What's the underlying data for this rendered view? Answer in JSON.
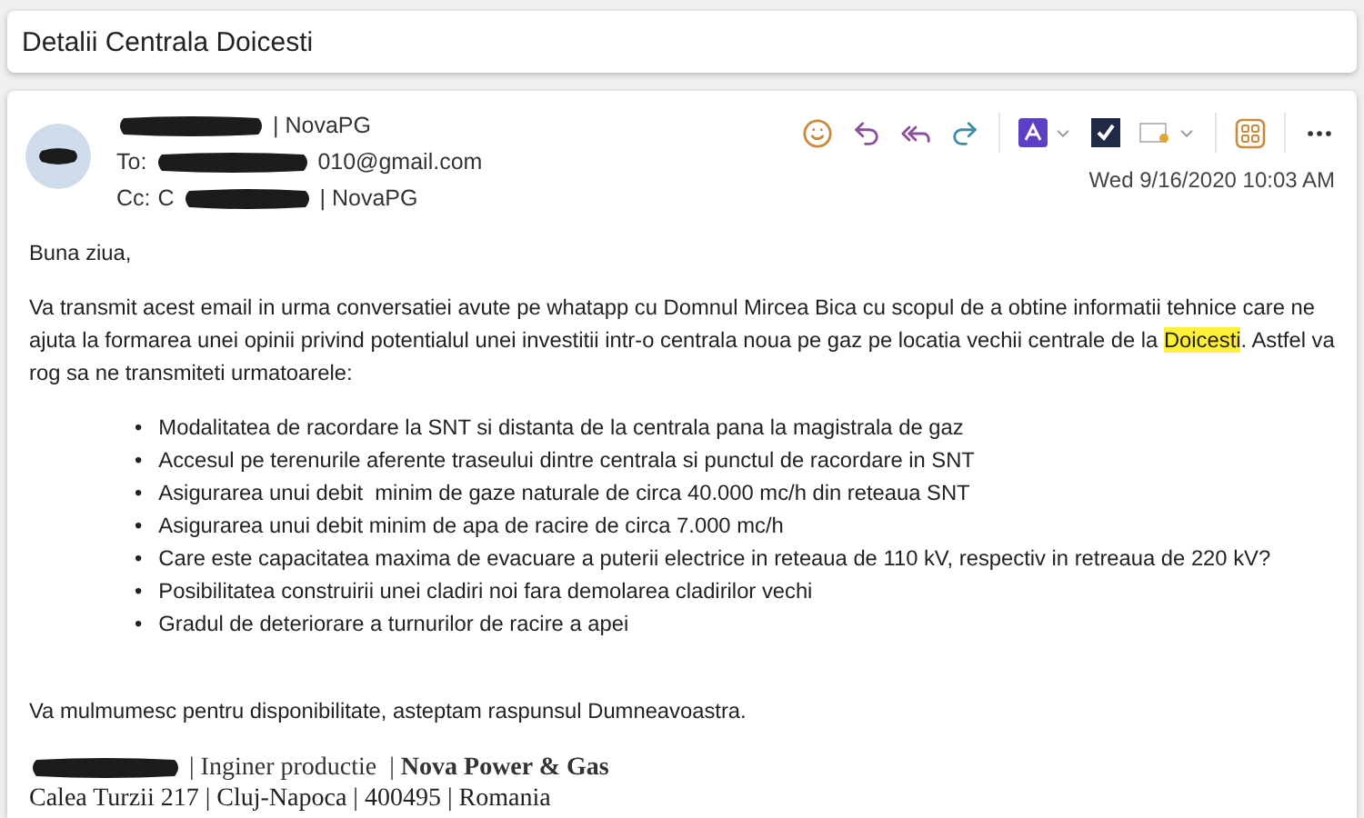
{
  "subject": "Detalii Centrala Doicesti",
  "header": {
    "sender_suffix": "| NovaPG",
    "to_label": "To:",
    "to_suffix": "010@gmail.com",
    "cc_label": "Cc:",
    "cc_prefix": "C",
    "cc_suffix": "| NovaPG",
    "date": "Wed 9/16/2020 10:03 AM"
  },
  "body": {
    "greeting": "Buna ziua,",
    "paragraph": [
      {
        "text": "Va transmit acest email in urma conversatiei avute pe whatapp cu Domnul Mircea Bica cu scopul de a obtine informatii tehnice care ne ajuta la formarea unei opinii privind potentialul unei investitii intr-o centrala noua pe gaz pe locatia vechii centrale de la ",
        "highlighted": false
      },
      {
        "text": "Doicesti",
        "highlighted": true
      },
      {
        "text": ". Astfel va rog sa ne transmiteti urmatoarele:",
        "highlighted": false
      }
    ],
    "bullets": [
      {
        "marker": "•",
        "text": "Modalitatea de racordare la SNT si distanta de la centrala pana la magistrala de gaz"
      },
      {
        "marker": "•",
        "text": "Accesul pe terenurile aferente traseului dintre centrala si punctul de racordare in SNT"
      },
      {
        "marker": "•",
        "text": "Asigurarea unui debit  minim de gaze naturale de circa 40.000 mc/h din reteaua SNT"
      },
      {
        "marker": "•",
        "text": "Asigurarea unui debit minim de apa de racire de circa 7.000 mc/h"
      },
      {
        "marker": "•",
        "text": "Care este capacitatea maxima de evacuare a puterii electrice in reteaua de 110 kV, respectiv in retreaua de 220 kV?"
      },
      {
        "marker": "•",
        "text": "Posibilitatea construirii unei cladiri noi fara demolarea cladirilor vechi"
      },
      {
        "marker": "•",
        "text": "Gradul de deteriorare a turnurilor de racire a apei"
      }
    ],
    "closing": "Va mulmumesc pentru disponibilitate, asteptam raspunsul Dumneavoastra."
  },
  "signature": {
    "line_1": "| Inginer productie  | **Nova Power & Gas**",
    "line_2": "Calea Turzii 217 | Cluj-Napoca | 400495 | Romania"
  }
}
